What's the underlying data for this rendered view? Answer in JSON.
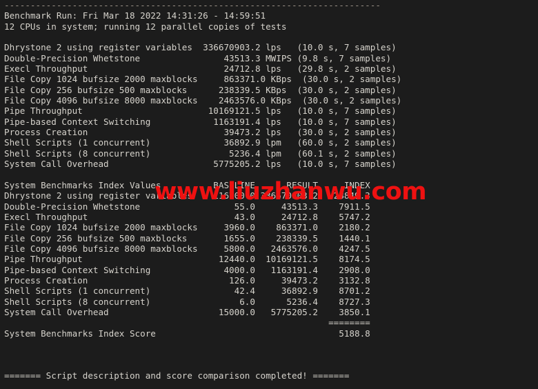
{
  "terminal": {
    "background_color": "#1c1c1c",
    "text_color": "#d6d3cc",
    "rule_top": "------------------------------------------------------------------------",
    "header": {
      "run_line": "Benchmark Run: Fri Mar 18 2022 14:31:26 - 14:59:51",
      "cpu_line": "12 CPUs in system; running 12 parallel copies of tests"
    },
    "raw_results": [
      {
        "name": "Dhrystone 2 using register variables",
        "value": "336670903.2",
        "unit": "lps",
        "timing": "(10.0 s, 7 samples)"
      },
      {
        "name": "Double-Precision Whetstone",
        "value": "43513.3",
        "unit": "MWIPS",
        "timing": "(9.8 s, 7 samples)"
      },
      {
        "name": "Execl Throughput",
        "value": "24712.8",
        "unit": "lps",
        "timing": "(29.8 s, 2 samples)"
      },
      {
        "name": "File Copy 1024 bufsize 2000 maxblocks",
        "value": "863371.0",
        "unit": "KBps",
        "timing": "(30.0 s, 2 samples)"
      },
      {
        "name": "File Copy 256 bufsize 500 maxblocks",
        "value": "238339.5",
        "unit": "KBps",
        "timing": "(30.0 s, 2 samples)"
      },
      {
        "name": "File Copy 4096 bufsize 8000 maxblocks",
        "value": "2463576.0",
        "unit": "KBps",
        "timing": "(30.0 s, 2 samples)"
      },
      {
        "name": "Pipe Throughput",
        "value": "10169121.5",
        "unit": "lps",
        "timing": "(10.0 s, 7 samples)"
      },
      {
        "name": "Pipe-based Context Switching",
        "value": "1163191.4",
        "unit": "lps",
        "timing": "(10.0 s, 7 samples)"
      },
      {
        "name": "Process Creation",
        "value": "39473.2",
        "unit": "lps",
        "timing": "(30.0 s, 2 samples)"
      },
      {
        "name": "Shell Scripts (1 concurrent)",
        "value": "36892.9",
        "unit": "lpm",
        "timing": "(60.0 s, 2 samples)"
      },
      {
        "name": "Shell Scripts (8 concurrent)",
        "value": "5236.4",
        "unit": "lpm",
        "timing": "(60.1 s, 2 samples)"
      },
      {
        "name": "System Call Overhead",
        "value": "5775205.2",
        "unit": "lps",
        "timing": "(10.0 s, 7 samples)"
      }
    ],
    "index_table": {
      "title": "System Benchmarks Index Values",
      "columns": [
        "BASELINE",
        "RESULT",
        "INDEX"
      ],
      "rows": [
        {
          "name": "Dhrystone 2 using register variables",
          "baseline": "116700.0",
          "result": "336670903.2",
          "index": "28849.3"
        },
        {
          "name": "Double-Precision Whetstone",
          "baseline": "55.0",
          "result": "43513.3",
          "index": "7911.5"
        },
        {
          "name": "Execl Throughput",
          "baseline": "43.0",
          "result": "24712.8",
          "index": "5747.2"
        },
        {
          "name": "File Copy 1024 bufsize 2000 maxblocks",
          "baseline": "3960.0",
          "result": "863371.0",
          "index": "2180.2"
        },
        {
          "name": "File Copy 256 bufsize 500 maxblocks",
          "baseline": "1655.0",
          "result": "238339.5",
          "index": "1440.1"
        },
        {
          "name": "File Copy 4096 bufsize 8000 maxblocks",
          "baseline": "5800.0",
          "result": "2463576.0",
          "index": "4247.5"
        },
        {
          "name": "Pipe Throughput",
          "baseline": "12440.0",
          "result": "10169121.5",
          "index": "8174.5"
        },
        {
          "name": "Pipe-based Context Switching",
          "baseline": "4000.0",
          "result": "1163191.4",
          "index": "2908.0"
        },
        {
          "name": "Process Creation",
          "baseline": "126.0",
          "result": "39473.2",
          "index": "3132.8"
        },
        {
          "name": "Shell Scripts (1 concurrent)",
          "baseline": "42.4",
          "result": "36892.9",
          "index": "8701.2"
        },
        {
          "name": "Shell Scripts (8 concurrent)",
          "baseline": "6.0",
          "result": "5236.4",
          "index": "8727.3"
        },
        {
          "name": "System Call Overhead",
          "baseline": "15000.0",
          "result": "5775205.2",
          "index": "3850.1"
        }
      ],
      "separator": "========",
      "score_label": "System Benchmarks Index Score",
      "score_value": "5188.8"
    },
    "footer": "======= Script description and score comparison completed! =======",
    "watermark": {
      "text": "www.liuzhanwu.com",
      "color": "#ee1111"
    }
  }
}
